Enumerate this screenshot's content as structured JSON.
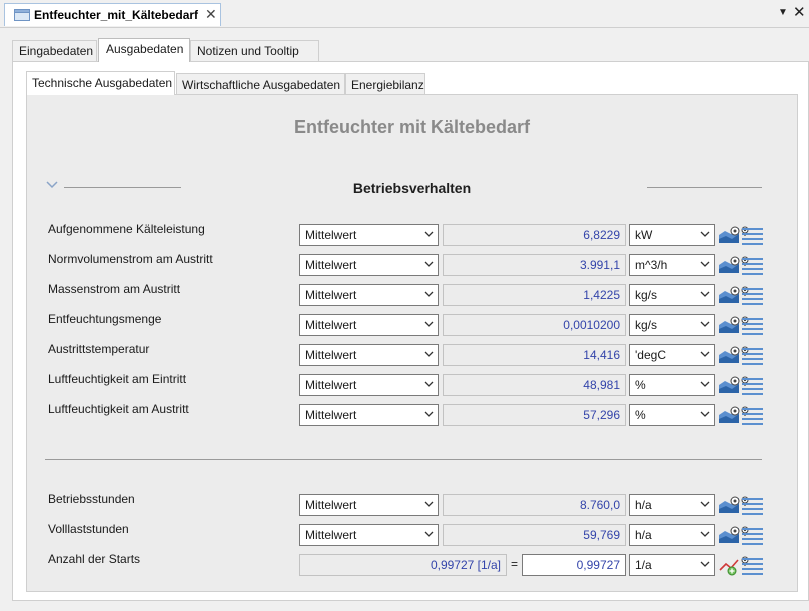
{
  "window": {
    "doc_tab_title": "Entfeuchter_mit_Kältebedarf",
    "doc_tab_close": "✕",
    "menu_glyph": "▼",
    "close_glyph": "✕"
  },
  "outer_tabs": [
    "Eingabedaten",
    "Ausgabedaten",
    "Notizen und Tooltip"
  ],
  "outer_active": "Ausgabedaten",
  "inner_tabs": [
    "Technische Ausgabedaten",
    "Wirtschaftliche Ausgabedaten",
    "Energiebilanz"
  ],
  "inner_active": "Technische Ausgabedaten",
  "main_title": "Entfeuchter mit Kältebedarf",
  "section_title": "Betriebsverhalten",
  "rows": [
    {
      "label": "Aufgenommene Kälteleistung",
      "mode": "Mittelwert",
      "value": "6,8229",
      "unit": "kW"
    },
    {
      "label": "Normvolumenstrom am Austritt",
      "mode": "Mittelwert",
      "value": "3.991,1",
      "unit": "m^3/h"
    },
    {
      "label": "Massenstrom am Austritt",
      "mode": "Mittelwert",
      "value": "1,4225",
      "unit": "kg/s"
    },
    {
      "label": "Entfeuchtungsmenge",
      "mode": "Mittelwert",
      "value": "0,0010200",
      "unit": "kg/s"
    },
    {
      "label": "Austrittstemperatur",
      "mode": "Mittelwert",
      "value": "14,416",
      "unit": "'degC"
    },
    {
      "label": "Luftfeuchtigkeit am Eintritt",
      "mode": "Mittelwert",
      "value": "48,981",
      "unit": "%"
    },
    {
      "label": "Luftfeuchtigkeit am Austritt",
      "mode": "Mittelwert",
      "value": "57,296",
      "unit": "%"
    }
  ],
  "rows2": [
    {
      "label": "Betriebsstunden",
      "mode": "Mittelwert",
      "value": "8.760,0",
      "unit": "h/a"
    },
    {
      "label": "Volllaststunden",
      "mode": "Mittelwert",
      "value": "59,769",
      "unit": "h/a"
    }
  ],
  "starts": {
    "label": "Anzahl der Starts",
    "computed": "0,99727 [1/a]",
    "equals": "=",
    "input": "0,99727",
    "unit": "1/a"
  },
  "icons": {
    "row_icon_a": "chart-settings-icon",
    "row_icon_b": "list-lines-icon",
    "starts_icon_a": "trend-chart-icon"
  }
}
